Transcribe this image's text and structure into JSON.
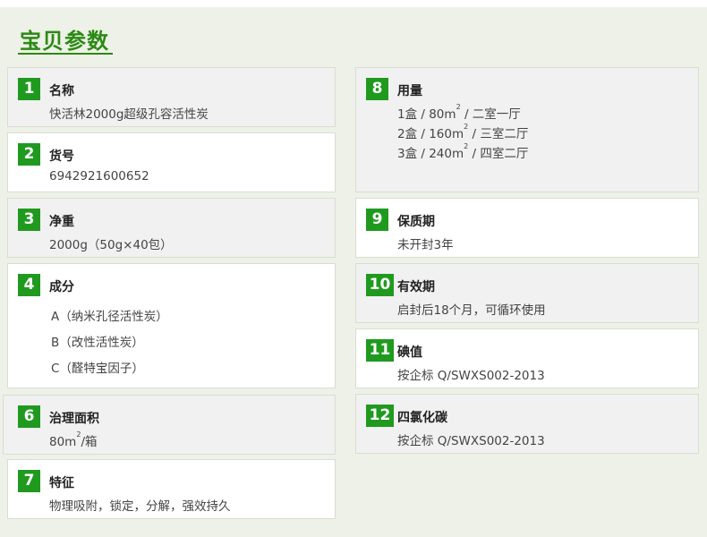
{
  "heading": "宝贝参数",
  "items": {
    "i1": {
      "num": "1",
      "title": "名称",
      "value": "快活林2000g超级孔容活性炭"
    },
    "i2": {
      "num": "2",
      "title": "货号",
      "value": "6942921600652"
    },
    "i3": {
      "num": "3",
      "title": "净重",
      "value": "2000g（50g×40包）"
    },
    "i4": {
      "num": "4",
      "title": "成分",
      "values": [
        "A（纳米孔径活性炭）",
        "B（改性活性炭）",
        "C（醛特宝因子）"
      ]
    },
    "i6": {
      "num": "6",
      "title": "治理面积",
      "value_pre": "80m",
      "value_sup": "2",
      "value_post": "/箱"
    },
    "i7": {
      "num": "7",
      "title": "特征",
      "value": "物理吸附，锁定，分解，强效持久"
    },
    "i8": {
      "num": "8",
      "title": "用量",
      "lines": [
        {
          "pre": "1盒 / 80m",
          "sup": "2",
          "post": " / 二室一厅"
        },
        {
          "pre": "2盒 / 160m",
          "sup": "2",
          "post": " / 三室二厅"
        },
        {
          "pre": "3盒 / 240m",
          "sup": "2",
          "post": " / 四室二厅"
        }
      ]
    },
    "i9": {
      "num": "9",
      "title": "保质期",
      "value": "未开封3年"
    },
    "i10": {
      "num": "10",
      "title": "有效期",
      "value": "启封后18个月，可循环使用"
    },
    "i11": {
      "num": "11",
      "title": "碘值",
      "value": "按企标 Q/SWXS002-2013"
    },
    "i12": {
      "num": "12",
      "title": "四氯化碳",
      "value": "按企标 Q/SWXS002-2013"
    }
  }
}
